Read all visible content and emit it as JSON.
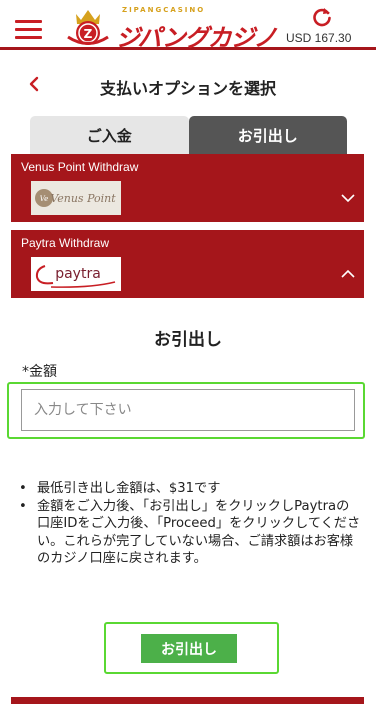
{
  "header": {
    "logo_small": "ZIPANGCASINO",
    "logo_text": "ジパングカジノ",
    "balance": "USD 167.30",
    "menu_icon": "hamburger-icon",
    "refresh_icon": "refresh-icon"
  },
  "page": {
    "title": "支払いオプションを選択",
    "back_icon": "chevron-left-icon"
  },
  "tabs": [
    {
      "label": "ご入金",
      "active": false
    },
    {
      "label": "お引出し",
      "active": true
    }
  ],
  "methods": [
    {
      "label": "Venus Point Withdraw",
      "logo_text": "Venus Point",
      "expanded": false
    },
    {
      "label": "Paytra Withdraw",
      "logo_text": "paytra",
      "expanded": true
    }
  ],
  "form": {
    "section_title": "お引出し",
    "amount_label": "*金額",
    "amount_placeholder": "入力して下さい",
    "amount_value": ""
  },
  "notes": [
    "最低引き出し金額は、$31です",
    "金額をご入力後、「お引出し」をクリックしPaytraの口座IDをご入力後、「Proceed」をクリックしてください。これらが完了していない場合、ご請求額はお客様のカジノ口座に戻されます。"
  ],
  "submit": {
    "label": "お引出し"
  },
  "colors": {
    "brand_red": "#a5161b",
    "accent_red": "#c81e24",
    "submit_green": "#4cb049",
    "highlight_green": "#5ad832",
    "tab_active_bg": "#555555",
    "tab_inactive_bg": "#e6e6e6"
  }
}
